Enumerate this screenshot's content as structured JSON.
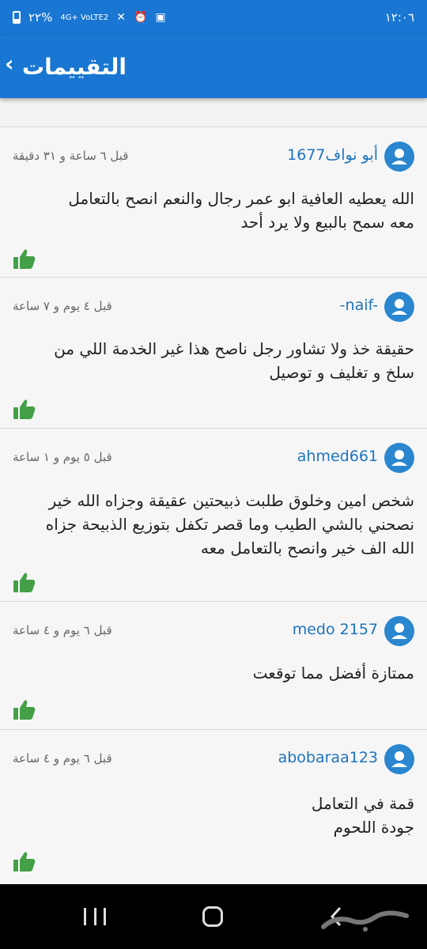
{
  "status_bar": {
    "time": "١٢:٠٦",
    "battery": "٢٢%",
    "network": "4G+ VoLTE2"
  },
  "header": {
    "title": "التقييمات",
    "back_icon": "chevron-icon"
  },
  "reviews": [
    {
      "user": "أبو نواف1677",
      "time": "قبل ٦ ساعة و ٣١ دقيقة",
      "text": "الله يعطيه العافية ابو عمر رجال والنعم انصح بالتعامل\nمعه سمح بالبيع ولا يرد أحد"
    },
    {
      "user": "-naif-",
      "time": "قبل ٤ يوم و ٧ ساعة",
      "text": "حقيقة خذ ولا تشاور رجل ناصح   هذا غير الخدمة اللي من\nسلخ و تغليف و توصيل"
    },
    {
      "user": "ahmed661",
      "time": "قبل ٥ يوم و ١ ساعة",
      "text": "شخص امين وخلوق طلبت ذبيحتين عقيقة وجزاه الله خير\nنصحني بالشي الطيب وما قصر تكفل بتوزيع الذبيحة جزاه\nالله الف خير وانصح بالتعامل معه"
    },
    {
      "user": "medo 2157",
      "time": "قبل ٦ يوم و ٤ ساعة",
      "text": "ممتازة أفضل مما توقعت"
    },
    {
      "user": "abobaraa123",
      "time": "قبل ٦ يوم و ٤ ساعة",
      "text": "قمة في التعامل\nجودة اللحوم"
    }
  ],
  "colors": {
    "primary": "#1976d2",
    "like": "#43a047",
    "username": "#1d73be"
  }
}
